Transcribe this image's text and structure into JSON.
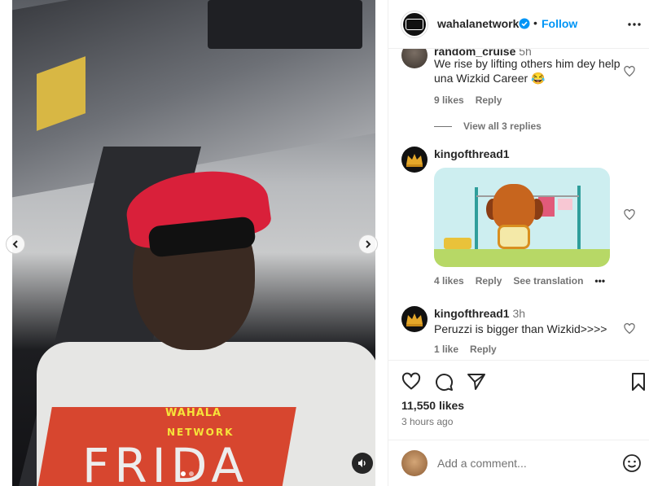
{
  "media": {
    "watermark_line1": "WAHALA",
    "watermark_line2": "NETWORK",
    "overlay_text": "FRIDA"
  },
  "header": {
    "username": "wahalanetwork",
    "separator": "•",
    "follow_label": "Follow"
  },
  "comments": [
    {
      "username": "random_cruise",
      "time": "5h",
      "text": "We rise by lifting others him dey help una Wizkid Career 😂",
      "likes": "9 likes",
      "reply_label": "Reply",
      "view_replies": "View all 3 replies"
    },
    {
      "username": "kingofthread1",
      "time": "",
      "likes": "4 likes",
      "reply_label": "Reply",
      "translation_label": "See translation",
      "more_label": "•••"
    },
    {
      "username": "kingofthread1",
      "time": "3h",
      "text": "Peruzzi is bigger than Wizkid>>>>",
      "likes": "1 like",
      "reply_label": "Reply"
    }
  ],
  "post": {
    "likes": "11,550 likes",
    "posted": "3 hours ago"
  },
  "composer": {
    "placeholder": "Add a comment..."
  },
  "colors": {
    "follow_blue": "#0095f6",
    "verified_blue": "#0095f6",
    "muted_text": "#737373"
  }
}
